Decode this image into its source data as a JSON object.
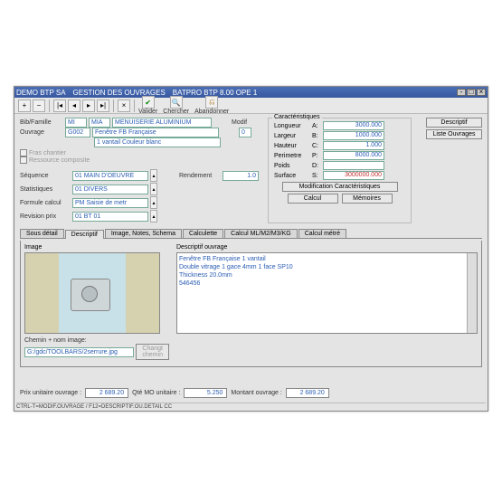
{
  "title": {
    "app": "DEMO BTP SA",
    "module": "GESTION DES OUVRAGES",
    "product": "BATPRO BTP   8.00   OPE   1"
  },
  "toolbar": {
    "valider": "Valider",
    "chercher": "Chercher",
    "abandonner": "Abandonner"
  },
  "bib": {
    "label": "Bib/Famille",
    "code1": "MI",
    "code2": "MIA",
    "desc": "MENUISERIE ALUMINIUM",
    "modif": "Modif"
  },
  "ouvrage": {
    "label": "Ouvrage",
    "code": "G002",
    "desc": "Fenêtre FB Française",
    "sub": "1 vantail Couleur blanc",
    "num": "0"
  },
  "chk1": "Fras chantier",
  "chk2": "Ressource composite",
  "seq": {
    "label": "Séquence",
    "val": "01 MAIN D'OEUVRE"
  },
  "stat": {
    "label": "Statistiques",
    "val": "01 DIVERS"
  },
  "formule": {
    "label": "Formule calcul",
    "val": "PM Saisie de metr"
  },
  "rev": {
    "label": "Revision prix",
    "val": "01 BT 01"
  },
  "rendement": {
    "label": "Rendement",
    "val": "1.0"
  },
  "carac": {
    "legend": "Caractéristiques",
    "rows": [
      {
        "l": "Longueur",
        "c": "A:",
        "v": "3000.000"
      },
      {
        "l": "Largeur",
        "c": "B:",
        "v": "1000.000"
      },
      {
        "l": "Hauteur",
        "c": "C:",
        "v": "1.000"
      },
      {
        "l": "Perimetre",
        "c": "P:",
        "v": "8000.000"
      },
      {
        "l": "Poids",
        "c": "D:",
        "v": ""
      },
      {
        "l": "Surface",
        "c": "S:",
        "v": "3000000.000"
      }
    ],
    "modif": "Modification Caractéristiques",
    "calcul": "Calcul",
    "memoires": "Mémoires"
  },
  "sidebtns": {
    "descriptif": "Descriptif",
    "liste": "Liste Ouvrages"
  },
  "tabs": [
    "Sous détail",
    "Descriptif",
    "Image, Notes, Schema",
    "Calculette",
    "Calcul ML/M2/M3/KG",
    "Calcul métré"
  ],
  "image": {
    "label": "Image",
    "pathLabel": "Chemin + nom image:",
    "path": "G:/gdc/TOOLBARS/2serrure.jpg",
    "change": "Changt chemin"
  },
  "desc": {
    "label": "Descriptif ouvrage",
    "text": "Fenêtre FB Française 1 vantail\nDouble vitrage 1 gace 4mm 1 face SP10\nThickness 20.0mm\n546456"
  },
  "bottom": {
    "pu": "Prix unitaire ouvrage :",
    "puVal": "2 689.20",
    "qte": "Qté MO unitaire :",
    "qteVal": "5.250",
    "montant": "Montant ouvrage :",
    "montantVal": "2 689.20"
  },
  "status": "CTRL-T=MODIF.OUVRAGE / F12=DESCRIPTIF.OU.DETAIL CC"
}
